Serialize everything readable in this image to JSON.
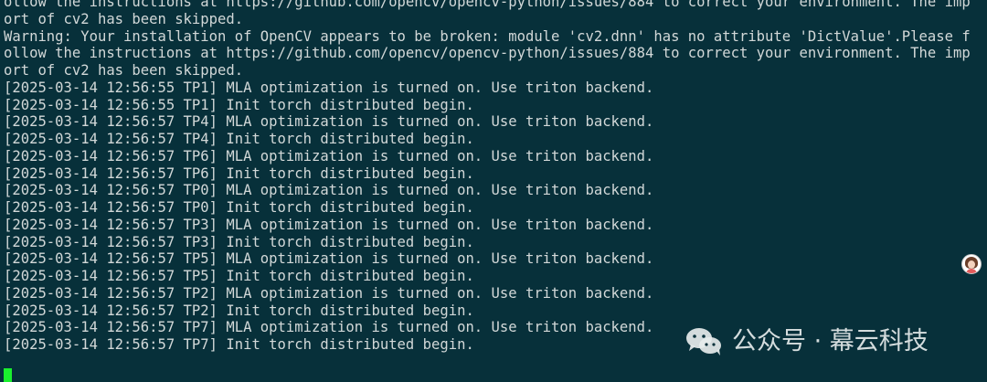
{
  "terminal": {
    "lines": [
      "ollow the instructions at https://github.com/opencv/opencv-python/issues/884 to correct your environment. The imp",
      "ort of cv2 has been skipped.",
      "Warning: Your installation of OpenCV appears to be broken: module 'cv2.dnn' has no attribute 'DictValue'.Please f",
      "ollow the instructions at https://github.com/opencv/opencv-python/issues/884 to correct your environment. The imp",
      "ort of cv2 has been skipped.",
      "[2025-03-14 12:56:55 TP1] MLA optimization is turned on. Use triton backend.",
      "[2025-03-14 12:56:55 TP1] Init torch distributed begin.",
      "[2025-03-14 12:56:57 TP4] MLA optimization is turned on. Use triton backend.",
      "[2025-03-14 12:56:57 TP4] Init torch distributed begin.",
      "[2025-03-14 12:56:57 TP6] MLA optimization is turned on. Use triton backend.",
      "[2025-03-14 12:56:57 TP6] Init torch distributed begin.",
      "[2025-03-14 12:56:57 TP0] MLA optimization is turned on. Use triton backend.",
      "[2025-03-14 12:56:57 TP0] Init torch distributed begin.",
      "[2025-03-14 12:56:57 TP3] MLA optimization is turned on. Use triton backend.",
      "[2025-03-14 12:56:57 TP3] Init torch distributed begin.",
      "[2025-03-14 12:56:57 TP5] MLA optimization is turned on. Use triton backend.",
      "[2025-03-14 12:56:57 TP5] Init torch distributed begin.",
      "[2025-03-14 12:56:57 TP2] MLA optimization is turned on. Use triton backend.",
      "[2025-03-14 12:56:57 TP2] Init torch distributed begin.",
      "[2025-03-14 12:56:57 TP7] MLA optimization is turned on. Use triton backend.",
      "[2025-03-14 12:56:57 TP7] Init torch distributed begin."
    ]
  },
  "watermark": {
    "text": "公众号 · 幕云科技",
    "icon": "wechat-icon"
  },
  "avatar": {
    "icon": "avatar-icon"
  },
  "colors": {
    "background": "#07303a",
    "text": "#d2d8d8",
    "cursor": "#1af02e"
  }
}
